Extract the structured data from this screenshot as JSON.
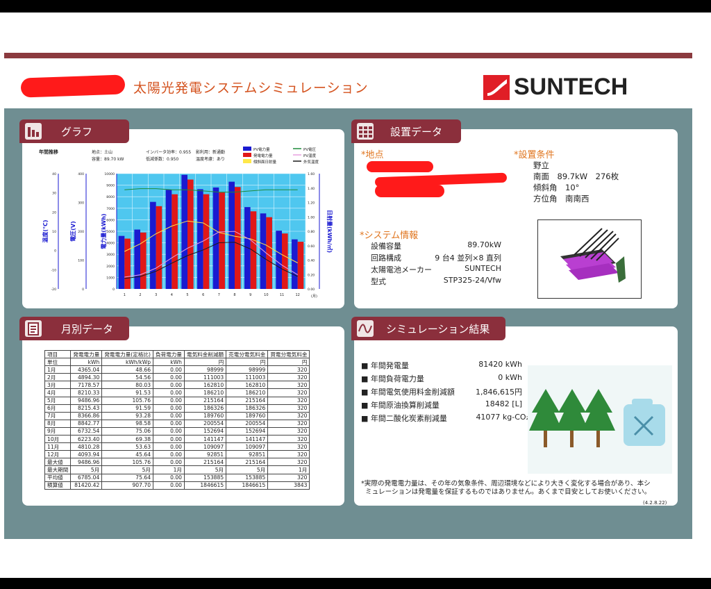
{
  "header": {
    "title": "太陽光発電システムシミュレーション",
    "logo_text": "SUNTECH"
  },
  "graph": {
    "tab_label": "グラフ",
    "heading": "年間推移",
    "info": [
      "地点：土山",
      "容量：89.70 kW",
      "インバータ効率：0.955",
      "低減係数：0.950",
      "影利用：新通勤",
      "温度考慮：あり"
    ],
    "legend": [
      "PV電力量",
      "発電電力量",
      "傾斜面日射量",
      "PV電圧",
      "PV温度",
      "外気温度"
    ],
    "y_labels": [
      "温度(℃)",
      "電圧(V)",
      "電力量(kWh)",
      "日射量(kWh/㎡)"
    ],
    "x_unit": "(月)",
    "temp_ticks": [
      "40",
      "30",
      "20",
      "10",
      "0",
      "-10",
      "-20"
    ],
    "volt_ticks": [
      "400",
      "300",
      "200",
      "100",
      "0"
    ],
    "kwh_ticks": [
      "10000",
      "9000",
      "8000",
      "7000",
      "6000",
      "5000",
      "4000",
      "3000",
      "2000",
      "1000",
      "0"
    ],
    "sun_ticks": [
      "1.60",
      "1.40",
      "1.20",
      "1.00",
      "0.80",
      "0.60",
      "0.40",
      "0.20",
      "0.00"
    ]
  },
  "chart_data": {
    "type": "bar",
    "categories": [
      "1",
      "2",
      "3",
      "4",
      "5",
      "6",
      "7",
      "8",
      "9",
      "10",
      "11",
      "12"
    ],
    "series": [
      {
        "name": "PV電力量",
        "color": "#1a1ad0",
        "values": [
          4600,
          5150,
          7550,
          8600,
          9900,
          8650,
          8800,
          9300,
          7100,
          6550,
          5050,
          4300
        ]
      },
      {
        "name": "発電電力量",
        "color": "#e01818",
        "values": [
          4365.04,
          4894.3,
          7178.57,
          8210.33,
          9486.96,
          8215.43,
          8366.86,
          8842.77,
          6732.54,
          6223.4,
          4810.28,
          4093.94
        ]
      }
    ],
    "ylim": [
      0,
      10000
    ],
    "xlabel": "(月)",
    "ylabel": "電力量(kWh)"
  },
  "setup": {
    "tab_label": "設置データ",
    "location_label": "*地点",
    "conditions_label": "*設置条件",
    "conditions": [
      "野立",
      "南面　89.7kW　276枚",
      "傾斜角　10°",
      "方位角　南南西"
    ],
    "system_label": "*システム情報",
    "system_rows": [
      {
        "k": "設備容量",
        "v": "89.70kW"
      },
      {
        "k": "回路構成",
        "v": "9 台4 並列×8 直列"
      },
      {
        "k": "太陽電池メーカー",
        "v": "SUNTECH"
      },
      {
        "k": "型式",
        "v": "STP325-24/Vfw"
      }
    ]
  },
  "monthly": {
    "tab_label": "月別データ",
    "headers": [
      "項目",
      "発電電力量",
      "発電電力量(定格比)",
      "負荷電力量",
      "電気料金削減額",
      "売電分電気料金",
      "買電分電気料金"
    ],
    "units": [
      "単位",
      "kWh",
      "kWh/kWp",
      "kWh",
      "円",
      "円",
      "円"
    ],
    "rows": [
      [
        "1月",
        "4365.04",
        "48.66",
        "0.00",
        "98999",
        "98999",
        "320"
      ],
      [
        "2月",
        "4894.30",
        "54.56",
        "0.00",
        "111003",
        "111003",
        "320"
      ],
      [
        "3月",
        "7178.57",
        "80.03",
        "0.00",
        "162810",
        "162810",
        "320"
      ],
      [
        "4月",
        "8210.33",
        "91.53",
        "0.00",
        "186210",
        "186210",
        "320"
      ],
      [
        "5月",
        "9486.96",
        "105.76",
        "0.00",
        "215164",
        "215164",
        "320"
      ],
      [
        "6月",
        "8215.43",
        "91.59",
        "0.00",
        "186326",
        "186326",
        "320"
      ],
      [
        "7月",
        "8366.86",
        "93.28",
        "0.00",
        "189760",
        "189760",
        "320"
      ],
      [
        "8月",
        "8842.77",
        "98.58",
        "0.00",
        "200554",
        "200554",
        "320"
      ],
      [
        "9月",
        "6732.54",
        "75.06",
        "0.00",
        "152694",
        "152694",
        "320"
      ],
      [
        "10月",
        "6223.40",
        "69.38",
        "0.00",
        "141147",
        "141147",
        "320"
      ],
      [
        "11月",
        "4810.28",
        "53.63",
        "0.00",
        "109097",
        "109097",
        "320"
      ],
      [
        "12月",
        "4093.94",
        "45.64",
        "0.00",
        "92851",
        "92851",
        "320"
      ],
      [
        "最大値",
        "9486.96",
        "105.76",
        "0.00",
        "215164",
        "215164",
        "320"
      ],
      [
        "最大期間",
        "5月",
        "5月",
        "1月",
        "5月",
        "5月",
        "1月"
      ],
      [
        "平均値",
        "6785.04",
        "75.64",
        "0.00",
        "153885",
        "153885",
        "320"
      ],
      [
        "積算値",
        "81420.42",
        "907.70",
        "0.00",
        "1846615",
        "1846615",
        "3843"
      ]
    ]
  },
  "results": {
    "tab_label": "シミュレーション結果",
    "rows": [
      {
        "k": "■ 年間発電量",
        "v": "81420 kWh"
      },
      {
        "k": "■ 年間負荷電力量",
        "v": "0 kWh"
      },
      {
        "k": "■ 年間電気使用料金削減額",
        "v": "1,846,615円"
      },
      {
        "k": "■ 年間原油換算削減量",
        "v": "18482 [L]"
      },
      {
        "k": "■ 年間二酸化炭素削減量",
        "v": "41077 kg-CO₂"
      }
    ],
    "footnote_1": "*実際の発電電力量は、その年の気象条件、周辺環境などにより大きく変化する場合があり、本シ",
    "footnote_2": "ミュレーションは発電量を保証するものではありません。あくまで目安としてお使いください。",
    "version": "(4.2.8.22)"
  },
  "colors": {
    "accent": "#8b2f3c",
    "orange": "#e07620",
    "bg": "#6f8e92",
    "plot_bg": "#4fc7ef"
  }
}
